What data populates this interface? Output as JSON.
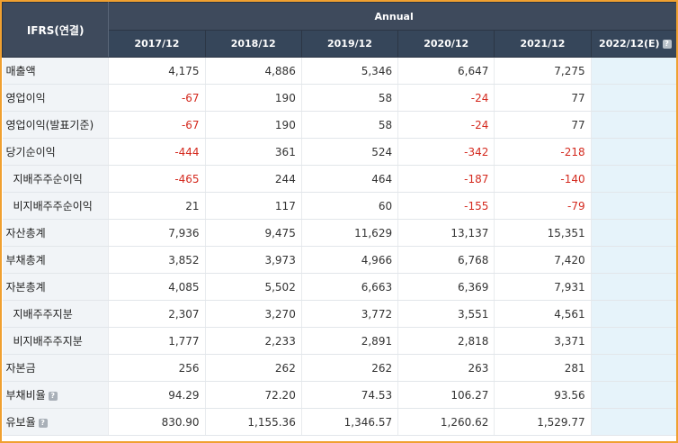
{
  "header": {
    "corner_label": "IFRS(연결)",
    "group_label": "Annual",
    "years": [
      "2017/12",
      "2018/12",
      "2019/12",
      "2020/12",
      "2021/12"
    ],
    "estimate_year": "2022/12(E)",
    "help_glyph": "?"
  },
  "colors": {
    "negative": "#d42a1f",
    "header_bg": "#3e4a5c",
    "estimate_bg": "#e6f3fa",
    "frame": "#f0a030"
  },
  "rows": [
    {
      "label": "매출액",
      "values": [
        "4,175",
        "4,886",
        "5,346",
        "6,647",
        "7,275"
      ],
      "estimate": ""
    },
    {
      "label": "영업이익",
      "values": [
        "-67",
        "190",
        "58",
        "-24",
        "77"
      ],
      "estimate": ""
    },
    {
      "label": "영업이익(발표기준)",
      "values": [
        "-67",
        "190",
        "58",
        "-24",
        "77"
      ],
      "estimate": ""
    },
    {
      "label": "당기순이익",
      "values": [
        "-444",
        "361",
        "524",
        "-342",
        "-218"
      ],
      "estimate": ""
    },
    {
      "label": "지배주주순이익",
      "values": [
        "-465",
        "244",
        "464",
        "-187",
        "-140"
      ],
      "estimate": ""
    },
    {
      "label": "비지배주주순이익",
      "values": [
        "21",
        "117",
        "60",
        "-155",
        "-79"
      ],
      "estimate": ""
    },
    {
      "label": "자산총계",
      "values": [
        "7,936",
        "9,475",
        "11,629",
        "13,137",
        "15,351"
      ],
      "estimate": ""
    },
    {
      "label": "부채총계",
      "values": [
        "3,852",
        "3,973",
        "4,966",
        "6,768",
        "7,420"
      ],
      "estimate": ""
    },
    {
      "label": "자본총계",
      "values": [
        "4,085",
        "5,502",
        "6,663",
        "6,369",
        "7,931"
      ],
      "estimate": ""
    },
    {
      "label": "지배주주지분",
      "values": [
        "2,307",
        "3,270",
        "3,772",
        "3,551",
        "4,561"
      ],
      "estimate": ""
    },
    {
      "label": "비지배주주지분",
      "values": [
        "1,777",
        "2,233",
        "2,891",
        "2,818",
        "3,371"
      ],
      "estimate": ""
    },
    {
      "label": "자본금",
      "values": [
        "256",
        "262",
        "262",
        "263",
        "281"
      ],
      "estimate": ""
    },
    {
      "label": "부채비율",
      "values": [
        "94.29",
        "72.20",
        "74.53",
        "106.27",
        "93.56"
      ],
      "estimate": ""
    },
    {
      "label": "유보율",
      "values": [
        "830.90",
        "1,155.36",
        "1,346.57",
        "1,260.62",
        "1,529.77"
      ],
      "estimate": ""
    }
  ]
}
